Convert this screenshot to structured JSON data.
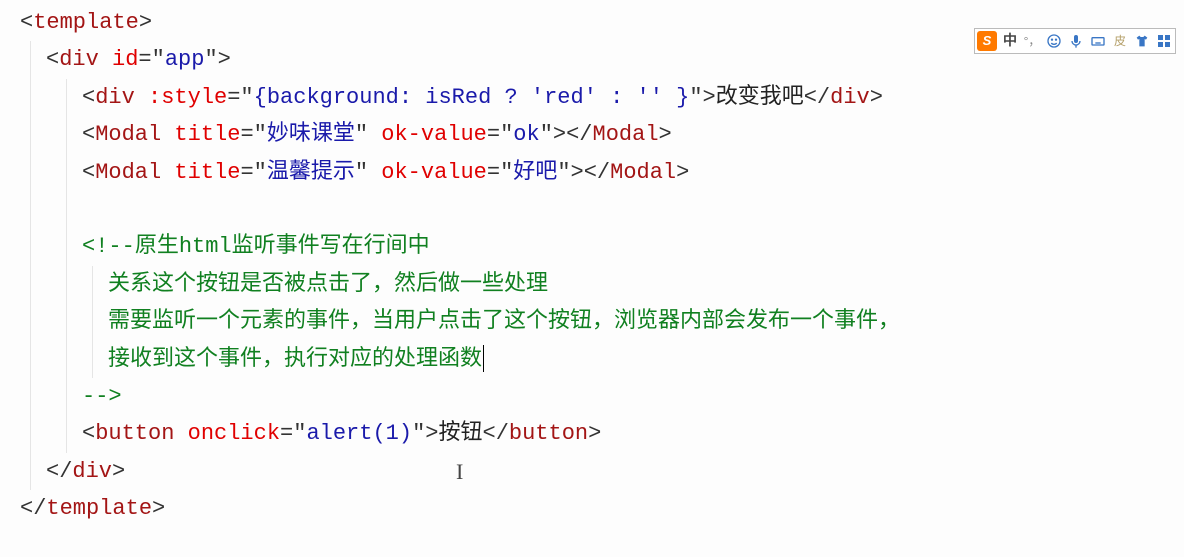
{
  "code": {
    "l1": {
      "open": "<",
      "tag": "template",
      "close": ">"
    },
    "l2": {
      "open": "<",
      "tag": "div",
      "sp": " ",
      "attr": "id",
      "eq": "=\"",
      "val": "app",
      "endq": "\"",
      "close": ">"
    },
    "l3": {
      "open": "<",
      "tag": "div",
      "sp": " ",
      "attr": ":style",
      "eq": "=\"",
      "val": "{background: isRed ? 'red' : '' }",
      "endq": "\"",
      "close": ">",
      "text": "改变我吧",
      "copen": "</",
      "ctag": "div",
      "cclose": ">"
    },
    "l4": {
      "open": "<",
      "tag": "Modal",
      "sp": " ",
      "a1": "title",
      "eq1": "=\"",
      "v1": "妙味课堂",
      "q1": "\"",
      "sp2": " ",
      "a2": "ok-value",
      "eq2": "=\"",
      "v2": "ok",
      "q2": "\"",
      "close": ">",
      "copen": "</",
      "ctag": "Modal",
      "cclose": ">"
    },
    "l5": {
      "open": "<",
      "tag": "Modal",
      "sp": " ",
      "a1": "title",
      "eq1": "=\"",
      "v1": "温馨提示",
      "q1": "\"",
      "sp2": " ",
      "a2": "ok-value",
      "eq2": "=\"",
      "v2": "好吧",
      "q2": "\"",
      "close": ">",
      "copen": "</",
      "ctag": "Modal",
      "cclose": ">"
    },
    "l7": {
      "opener": "<!--",
      "text": "原生html监听事件写在行间中"
    },
    "l8": "关系这个按钮是否被点击了，然后做一些处理",
    "l9": "需要监听一个元素的事件，当用户点击了这个按钮，浏览器内部会发布一个事件，",
    "l10": "接收到这个事件，执行对应的处理函数",
    "l11": "-->",
    "l12": {
      "open": "<",
      "tag": "button",
      "sp": " ",
      "attr": "onclick",
      "eq": "=\"",
      "val": "alert(1)",
      "endq": "\"",
      "close": ">",
      "text": "按钮",
      "copen": "</",
      "ctag": "button",
      "cclose": ">"
    },
    "l13": {
      "open": "</",
      "tag": "div",
      "close": ">"
    },
    "l14": {
      "open": "</",
      "tag": "template",
      "close": ">"
    }
  },
  "ime": {
    "logo": "S",
    "lang": "中",
    "punct": "°，"
  }
}
